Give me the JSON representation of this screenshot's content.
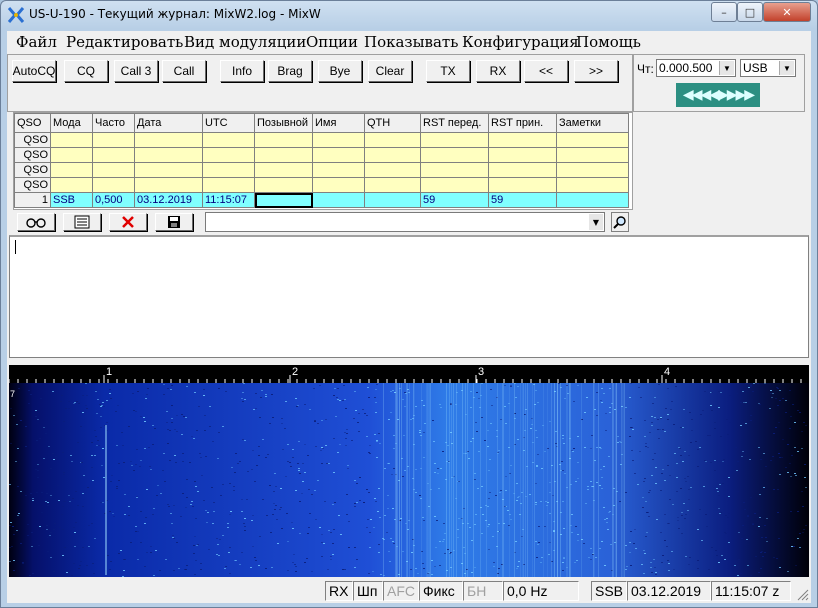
{
  "window": {
    "title": "US-U-190 - Текущий журнал: MixW2.log - MixW",
    "controls": {
      "minimize": "–",
      "maximize": "□",
      "close": "✕"
    }
  },
  "menu": [
    "Файл",
    "Редактировать",
    "Вид модуляции",
    "Опции",
    "Показывать",
    "Конфигурация",
    "Помощь"
  ],
  "toolbar": [
    "AutoCQ",
    "CQ",
    "Call 3",
    "Call",
    "Info",
    "Brag",
    "Bye",
    "Clear",
    "TX",
    "RX",
    "<<",
    ">>"
  ],
  "freq": {
    "label": "Чт:",
    "value": "0.000.500",
    "mode": "USB",
    "tune_glyphs": "◀◀◀◀▶▶▶▶"
  },
  "log": {
    "headers": [
      "QSO",
      "Мода",
      "Часто",
      "Дата",
      "UTC",
      "Позывной",
      "Имя",
      "QTH",
      "RST перед.",
      "RST прин.",
      "Заметки"
    ],
    "empty_rows": [
      "QSO",
      "QSO",
      "QSO",
      "QSO"
    ],
    "current": {
      "index": "1",
      "cells": [
        "SSB",
        "0,500",
        "03.12.2019",
        "11:15:07",
        "",
        "",
        "",
        "59",
        "59",
        ""
      ]
    }
  },
  "icons": {
    "lookup": "binoculars-icon",
    "card": "card-icon",
    "delete": "delete-icon",
    "save": "save-icon",
    "search": "magnifier-icon"
  },
  "waterfall": {
    "scale_labels": [
      "1",
      "2",
      "3",
      "4"
    ],
    "marker": "7"
  },
  "status": {
    "rx": "RX",
    "shp": "Шп",
    "afc": "AFC",
    "fix": "Фикс",
    "bn": "БН",
    "hz": "0,0 Hz",
    "mode": "SSB",
    "date": "03.12.2019",
    "time": "11:15:07 z"
  },
  "colors": {
    "log_empty": "#ffffc0",
    "log_current": "#80ffff",
    "waterfall_bg": "#000000",
    "tune_bar": "#2c8f82"
  }
}
